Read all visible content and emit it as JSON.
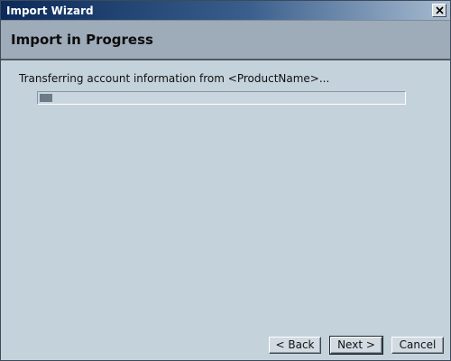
{
  "window": {
    "title": "Import Wizard"
  },
  "header": {
    "title": "Import in Progress"
  },
  "main": {
    "status_text": "Transferring account information from <ProductName>...",
    "progress_fraction": 0.035
  },
  "buttons": {
    "back_label": "< Back",
    "next_label": "Next >",
    "cancel_label": "Cancel"
  },
  "icons": {
    "close": "close-icon"
  }
}
